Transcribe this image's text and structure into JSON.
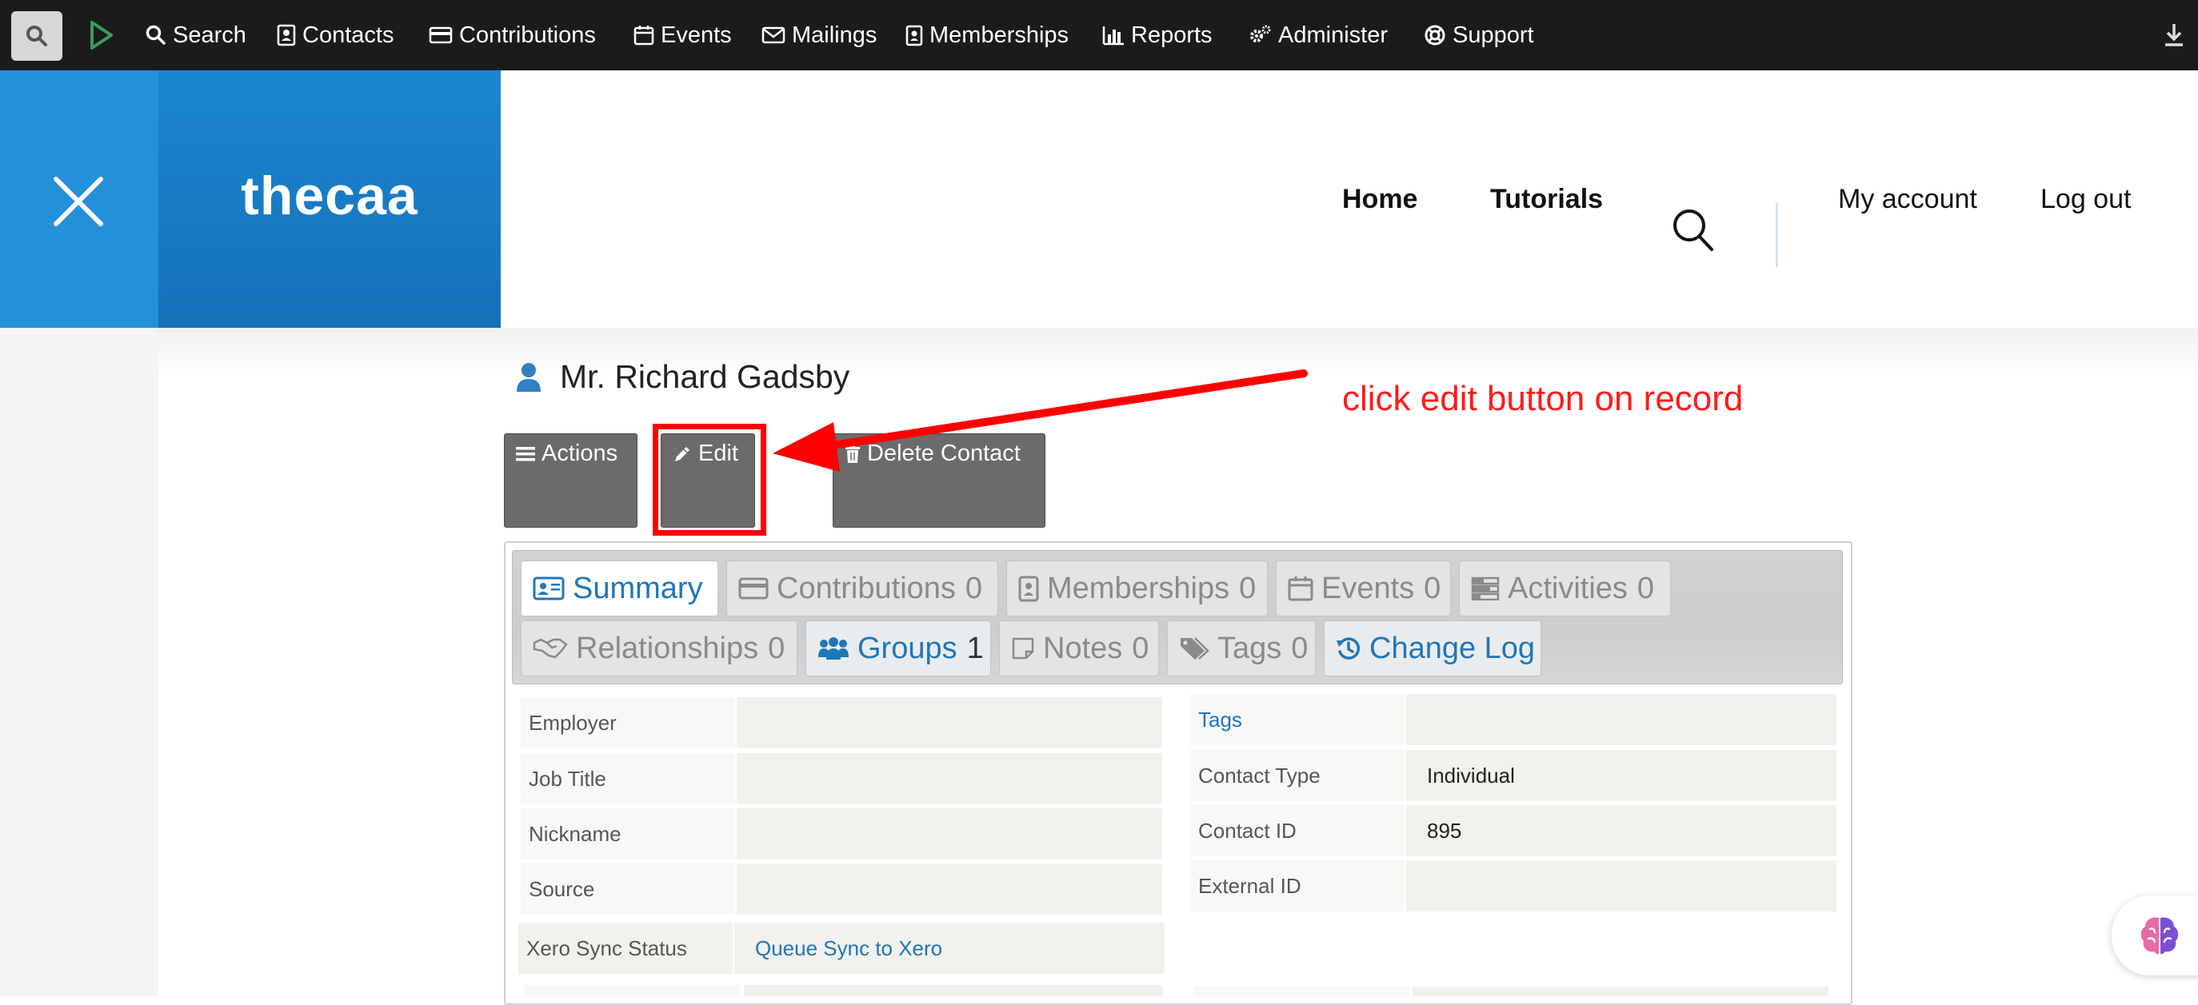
{
  "menubar": {
    "items": [
      {
        "label": "Search",
        "icon": "search-icon"
      },
      {
        "label": "Contacts",
        "icon": "contacts-icon"
      },
      {
        "label": "Contributions",
        "icon": "credit-card-icon"
      },
      {
        "label": "Events",
        "icon": "calendar-icon"
      },
      {
        "label": "Mailings",
        "icon": "envelope-icon"
      },
      {
        "label": "Memberships",
        "icon": "id-badge-icon"
      },
      {
        "label": "Reports",
        "icon": "bar-chart-icon"
      },
      {
        "label": "Administer",
        "icon": "gears-icon"
      },
      {
        "label": "Support",
        "icon": "life-ring-icon"
      }
    ]
  },
  "site_header": {
    "brand": "thecaa",
    "nav": [
      {
        "label": "Home"
      },
      {
        "label": "Tutorials"
      },
      {
        "label": "My account"
      },
      {
        "label": "Log out"
      }
    ]
  },
  "contact": {
    "name": "Mr. Richard Gadsby"
  },
  "actions": {
    "actions_label": "Actions",
    "edit_label": "Edit",
    "delete_label": "Delete Contact"
  },
  "annotation": {
    "text": "click edit button on record"
  },
  "tabs": [
    {
      "label": "Summary",
      "count": ""
    },
    {
      "label": "Contributions",
      "count": "0"
    },
    {
      "label": "Memberships",
      "count": "0"
    },
    {
      "label": "Events",
      "count": "0"
    },
    {
      "label": "Activities",
      "count": "0"
    },
    {
      "label": "Relationships",
      "count": "0"
    },
    {
      "label": "Groups",
      "count": "1"
    },
    {
      "label": "Notes",
      "count": "0"
    },
    {
      "label": "Tags",
      "count": "0"
    },
    {
      "label": "Change Log",
      "count": ""
    }
  ],
  "left_fields": [
    {
      "label": "Employer",
      "value": ""
    },
    {
      "label": "Job Title",
      "value": ""
    },
    {
      "label": "Nickname",
      "value": ""
    },
    {
      "label": "Source",
      "value": ""
    },
    {
      "label": "Xero Sync Status",
      "value": "Queue Sync to Xero"
    }
  ],
  "right_fields": [
    {
      "label": "Tags",
      "value": ""
    },
    {
      "label": "Contact Type",
      "value": "Individual"
    },
    {
      "label": "Contact ID",
      "value": "895"
    },
    {
      "label": "External ID",
      "value": ""
    }
  ],
  "colors": {
    "menubar_bg": "#1b1b1b",
    "brand_blue": "#1a86d0",
    "link_blue": "#2176b8",
    "annotation_red": "#ff0000",
    "button_gray": "#6b6b6b"
  }
}
